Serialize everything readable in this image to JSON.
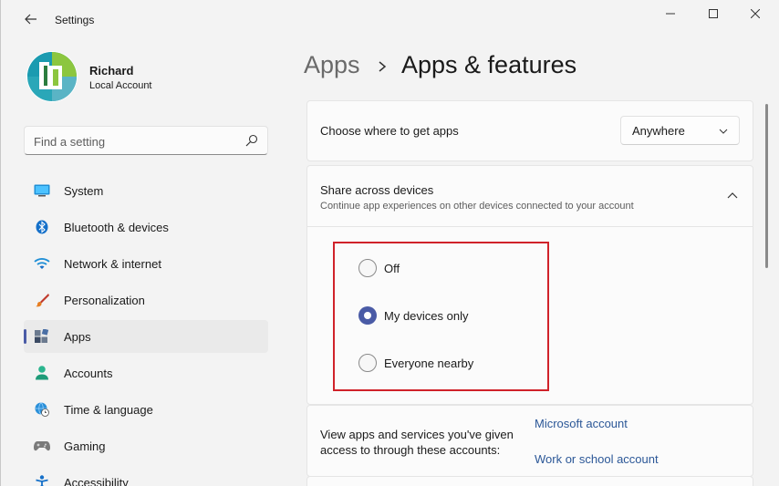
{
  "window": {
    "title": "Settings"
  },
  "profile": {
    "name": "Richard",
    "account_type": "Local Account"
  },
  "search": {
    "placeholder": "Find a setting"
  },
  "sidebar": {
    "items": [
      {
        "label": "System",
        "icon": "monitor-icon",
        "active": false
      },
      {
        "label": "Bluetooth & devices",
        "icon": "bluetooth-icon",
        "active": false
      },
      {
        "label": "Network & internet",
        "icon": "wifi-icon",
        "active": false
      },
      {
        "label": "Personalization",
        "icon": "brush-icon",
        "active": false
      },
      {
        "label": "Apps",
        "icon": "apps-icon",
        "active": true
      },
      {
        "label": "Accounts",
        "icon": "person-icon",
        "active": false
      },
      {
        "label": "Time & language",
        "icon": "globe-clock-icon",
        "active": false
      },
      {
        "label": "Gaming",
        "icon": "gamepad-icon",
        "active": false
      },
      {
        "label": "Accessibility",
        "icon": "accessibility-icon",
        "active": false
      }
    ]
  },
  "breadcrumb": {
    "parent": "Apps",
    "current": "Apps & features"
  },
  "where_to_get": {
    "label": "Choose where to get apps",
    "value": "Anywhere"
  },
  "share": {
    "title": "Share across devices",
    "description": "Continue app experiences on other devices connected to your account",
    "options": [
      {
        "label": "Off",
        "checked": false
      },
      {
        "label": "My devices only",
        "checked": true
      },
      {
        "label": "Everyone nearby",
        "checked": false
      }
    ]
  },
  "accounts": {
    "text": "View apps and services you've given access to through these accounts:",
    "links": [
      "Microsoft account",
      "Work or school account"
    ]
  },
  "colors": {
    "accent": "#4a5ba6",
    "highlight": "#d0222a",
    "link": "#2b5797"
  }
}
